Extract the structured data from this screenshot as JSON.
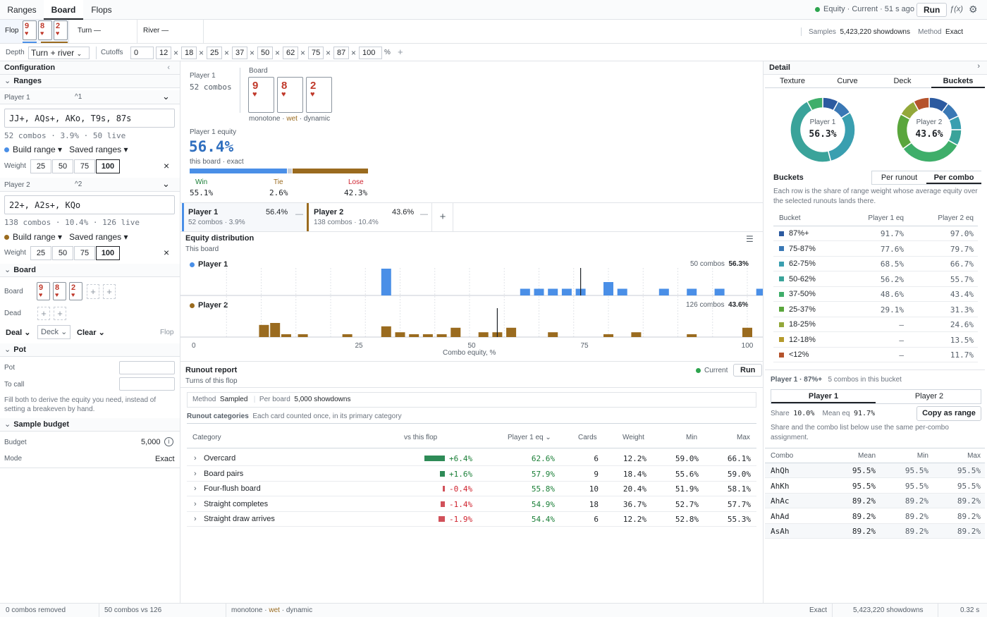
{
  "top": {
    "tabs": [
      "Ranges",
      "Board",
      "Flops"
    ],
    "active_tab": "Board",
    "status": "Equity · Current · 51 s ago",
    "run": "Run",
    "fx": "ƒ(x)"
  },
  "streets": {
    "flop_label": "Flop",
    "flop_cards": [
      {
        "rank": "9",
        "suit": "♥"
      },
      {
        "rank": "8",
        "suit": "♥"
      },
      {
        "rank": "2",
        "suit": "♥"
      }
    ],
    "turn": "Turn —",
    "river": "River —",
    "samples_label": "Samples",
    "samples_value": "5,423,220 showdowns",
    "method_label": "Method",
    "method_value": "Exact"
  },
  "depth": {
    "label": "Depth",
    "value": "Turn + river",
    "cutoffs_label": "Cutoffs",
    "cutoffs": [
      "0",
      "12",
      "18",
      "25",
      "37",
      "50",
      "62",
      "75",
      "87",
      "100"
    ],
    "pct": "%",
    "add": "+"
  },
  "config": {
    "title": "Configuration",
    "ranges_title": "Ranges",
    "p1_label": "Player 1",
    "p1_key": "^1",
    "p1_range": "JJ+, AQs+, AKo, T9s, 87s",
    "p1_stats": "52 combos · 3.9% · 50 live",
    "p2_label": "Player 2",
    "p2_key": "^2",
    "p2_range": "22+, A2s+, KQo",
    "p2_stats": "138 combos · 10.4% · 126 live",
    "build": "Build range ▾",
    "saved": "Saved ranges ▾",
    "weight_label": "Weight",
    "weights": [
      "25",
      "50",
      "75",
      "100"
    ],
    "board_title": "Board",
    "board_label": "Board",
    "dead_label": "Dead",
    "deal": "Deal",
    "deck": "Deck",
    "clear": "Clear",
    "street_tag": "Flop",
    "pot_title": "Pot",
    "pot_label": "Pot",
    "tocall_label": "To call",
    "pot_hint": "Fill both to derive the equity you need, instead of setting a breakeven by hand.",
    "budget_title": "Sample budget",
    "budget_label": "Budget",
    "budget_value": "5,000",
    "mode_label": "Mode",
    "mode_value": "Exact"
  },
  "summary": {
    "p1": "Player 1",
    "p1_combos": "52 combos",
    "board_label": "Board",
    "texture": [
      "monotone",
      "wet",
      "dynamic"
    ],
    "equity_label": "Player 1 equity",
    "equity": "56.4%",
    "equity_sub": "this board · exact",
    "win_label": "Win",
    "win": "55.1%",
    "tie_label": "Tie",
    "tie": "2.6%",
    "lose_label": "Lose",
    "lose": "42.3%",
    "win_frac": 0.551,
    "tie_frac": 0.026,
    "lose_frac": 0.423
  },
  "players": [
    {
      "name": "Player 1",
      "equity": "56.4%",
      "sub": "52 combos · 3.9%",
      "color": "#4a8fe7"
    },
    {
      "name": "Player 2",
      "equity": "43.6%",
      "sub": "138 combos · 10.4%",
      "color": "#9a6b1f"
    }
  ],
  "dist": {
    "title": "Equity distribution",
    "sub": "This board",
    "p1_name": "Player 1",
    "p1_combos": "50 combos",
    "p1_eq": "56.3%",
    "p2_name": "Player 2",
    "p2_combos": "126 combos",
    "p2_eq": "43.6%",
    "axis_label": "Combo equity, %",
    "ticks": [
      "0",
      "25",
      "50",
      "75",
      "100"
    ],
    "p1_bars": [
      [
        35,
        1.0
      ],
      [
        60,
        0.25
      ],
      [
        62.5,
        0.25
      ],
      [
        65,
        0.25
      ],
      [
        67.5,
        0.25
      ],
      [
        70,
        0.25
      ],
      [
        75,
        0.5
      ],
      [
        77.5,
        0.25
      ],
      [
        85,
        0.25
      ],
      [
        90,
        0.25
      ],
      [
        95,
        0.25
      ],
      [
        102.5,
        0.25
      ],
      [
        110,
        0.14
      ]
    ],
    "p1_mean": 70,
    "p2_bars": [
      [
        13,
        0.43
      ],
      [
        15,
        0.5
      ],
      [
        17,
        0.1
      ],
      [
        20,
        0.1
      ],
      [
        28,
        0.1
      ],
      [
        35,
        0.38
      ],
      [
        37.5,
        0.17
      ],
      [
        40,
        0.1
      ],
      [
        42.5,
        0.1
      ],
      [
        45,
        0.1
      ],
      [
        47.5,
        0.33
      ],
      [
        52.5,
        0.17
      ],
      [
        55,
        0.17
      ],
      [
        57.5,
        0.33
      ],
      [
        65,
        0.17
      ],
      [
        75,
        0.1
      ],
      [
        80,
        0.17
      ],
      [
        90,
        0.1
      ],
      [
        100,
        0.33
      ],
      [
        110,
        0.17
      ],
      [
        120,
        0.33
      ]
    ],
    "p2_mean": 55
  },
  "runout": {
    "title": "Runout report",
    "sub": "Turns of this flop",
    "state": "Current",
    "run": "Run",
    "method_label": "Method",
    "method_value": "Sampled",
    "per_board_label": "Per board",
    "per_board_value": "5,000 showdowns",
    "cats_label": "Runout categories",
    "cats_hint": "Each card counted once, in its primary category",
    "headers": [
      "Category",
      "vs this flop",
      "Player 1 eq ⌄",
      "Cards",
      "Weight",
      "Min",
      "Max"
    ],
    "rows": [
      {
        "cat": "Overcard",
        "delta": "+6.4%",
        "d": 6.4,
        "eq": "62.6%",
        "cards": "6",
        "weight": "12.2%",
        "min": "59.0%",
        "max": "66.1%"
      },
      {
        "cat": "Board pairs",
        "delta": "+1.6%",
        "d": 1.6,
        "eq": "57.9%",
        "cards": "9",
        "weight": "18.4%",
        "min": "55.6%",
        "max": "59.0%"
      },
      {
        "cat": "Four-flush board",
        "delta": "-0.4%",
        "d": -0.4,
        "eq": "55.8%",
        "cards": "10",
        "weight": "20.4%",
        "min": "51.9%",
        "max": "58.1%"
      },
      {
        "cat": "Straight completes",
        "delta": "-1.4%",
        "d": -1.4,
        "eq": "54.9%",
        "cards": "18",
        "weight": "36.7%",
        "min": "52.7%",
        "max": "57.7%"
      },
      {
        "cat": "Straight draw arrives",
        "delta": "-1.9%",
        "d": -1.9,
        "eq": "54.4%",
        "cards": "6",
        "weight": "12.2%",
        "min": "52.8%",
        "max": "55.3%"
      }
    ]
  },
  "detail": {
    "title": "Detail",
    "tabs": [
      "Texture",
      "Curve",
      "Deck",
      "Buckets"
    ],
    "active": "Buckets",
    "donut1_name": "Player 1",
    "donut1_value": "56.3%",
    "donut2_name": "Player 2",
    "donut2_value": "43.6%",
    "buckets_title": "Buckets",
    "toggle": [
      "Per runout",
      "Per combo"
    ],
    "hint": "Each row is the share of range weight whose average equity over the selected runouts lands there.",
    "headers": [
      "Bucket",
      "Player 1 eq",
      "Player 2 eq"
    ],
    "rows": [
      {
        "b": "87%+",
        "p1": "91.7%",
        "p2": "97.0%",
        "color": "#2c5aa0"
      },
      {
        "b": "75-87%",
        "p1": "77.6%",
        "p2": "79.7%",
        "color": "#3a78b5"
      },
      {
        "b": "62-75%",
        "p1": "68.5%",
        "p2": "66.7%",
        "color": "#3a9fb0"
      },
      {
        "b": "50-62%",
        "p1": "56.2%",
        "p2": "55.7%",
        "color": "#3aa39a"
      },
      {
        "b": "37-50%",
        "p1": "48.6%",
        "p2": "43.4%",
        "color": "#3fae6a"
      },
      {
        "b": "25-37%",
        "p1": "29.1%",
        "p2": "31.3%",
        "color": "#5aa63c"
      },
      {
        "b": "18-25%",
        "p1": "—",
        "p2": "24.6%",
        "color": "#93a83a"
      },
      {
        "b": "12-18%",
        "p1": "—",
        "p2": "13.5%",
        "color": "#b59a2c"
      },
      {
        "b": "<12%",
        "p1": "—",
        "p2": "11.7%",
        "color": "#b5532c"
      }
    ],
    "donut1": [
      0.08,
      0.08,
      0.3,
      0.46,
      0.08
    ],
    "donut2": [
      0.1,
      0.08,
      0.07,
      0.08,
      0.32,
      0.18,
      0.09,
      0.08
    ],
    "sel_label": "Player 1 · 87%+",
    "sel_sub": "5 combos in this bucket",
    "ptabs": [
      "Player 1",
      "Player 2"
    ],
    "share_label": "Share",
    "share": "10.0%",
    "mean_label": "Mean eq",
    "mean": "91.7%",
    "copy": "Copy as range",
    "note": "Share and the combo list below use the same per-combo assignment.",
    "combo_headers": [
      "Combo",
      "Mean",
      "Min",
      "Max"
    ],
    "combos": [
      {
        "c": "AhQh",
        "mean": "95.5%",
        "min": "95.5%",
        "max": "95.5%"
      },
      {
        "c": "AhKh",
        "mean": "95.5%",
        "min": "95.5%",
        "max": "95.5%"
      },
      {
        "c": "AhAc",
        "mean": "89.2%",
        "min": "89.2%",
        "max": "89.2%"
      },
      {
        "c": "AhAd",
        "mean": "89.2%",
        "min": "89.2%",
        "max": "89.2%"
      },
      {
        "c": "AsAh",
        "mean": "89.2%",
        "min": "89.2%",
        "max": "89.2%"
      }
    ]
  },
  "footer": {
    "removed": "0 combos removed",
    "vs": "50 combos vs 126",
    "texture": [
      "monotone",
      "wet",
      "dynamic"
    ],
    "method": "Exact",
    "showdowns": "5,423,220 showdowns",
    "time": "0.32 s"
  },
  "colors": {
    "p1": "#4a8fe7",
    "p2": "#9a6b1f",
    "accent": "#2f6fbf",
    "green": "#1a7f37",
    "red": "#cf222e"
  }
}
